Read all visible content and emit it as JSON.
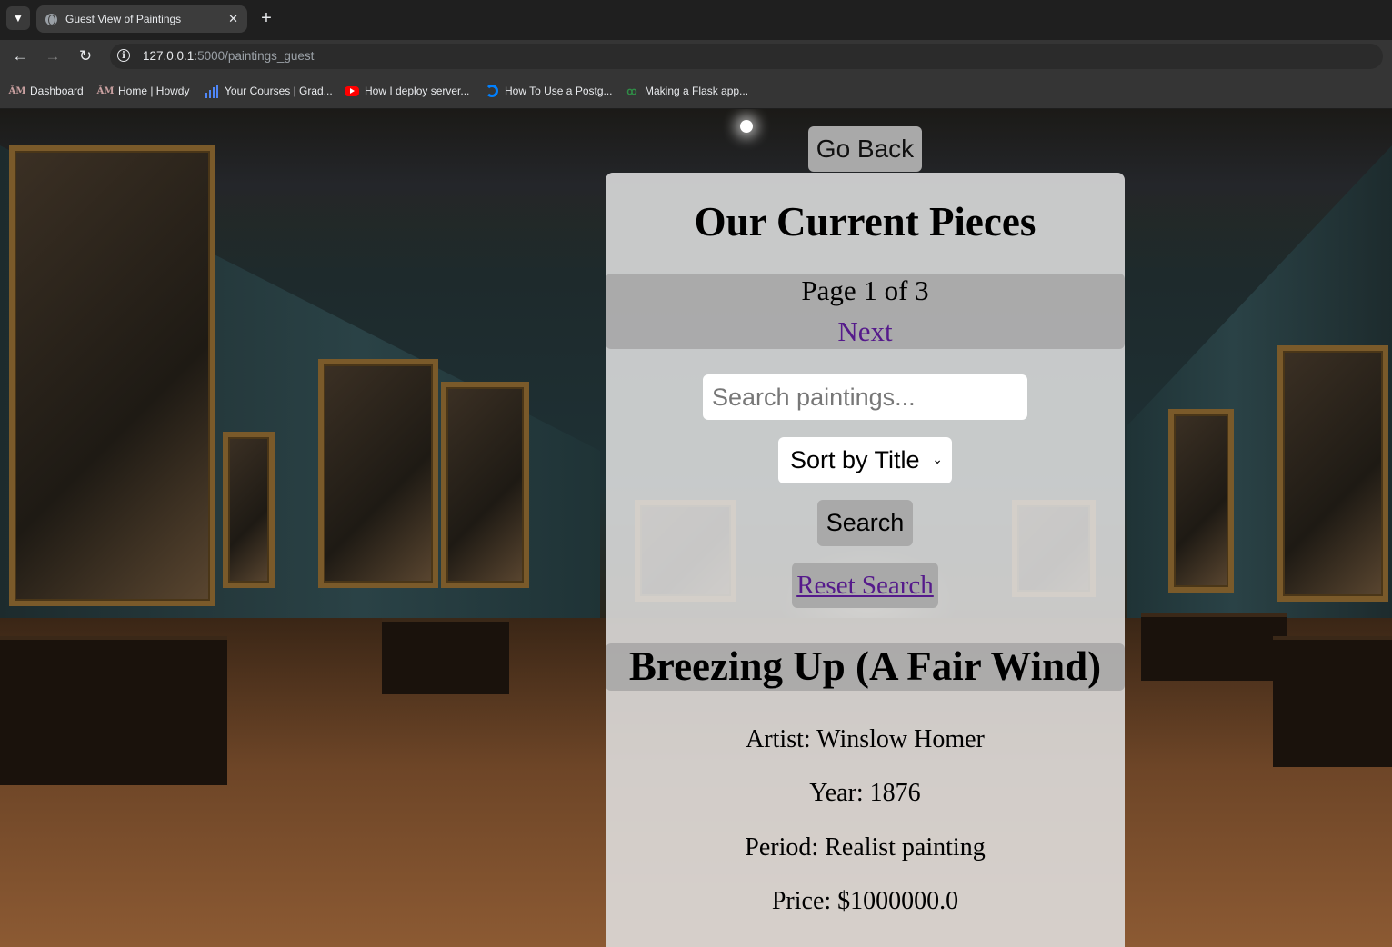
{
  "browser": {
    "tab_title": "Guest View of Paintings",
    "url_host": "127.0.0.1",
    "url_rest": ":5000/paintings_guest",
    "bookmarks": [
      {
        "label": "Dashboard",
        "icon": "tamu-icon"
      },
      {
        "label": "Home | Howdy",
        "icon": "tamu-icon"
      },
      {
        "label": "Your Courses | Grad...",
        "icon": "bar-chart-icon"
      },
      {
        "label": "How I deploy server...",
        "icon": "youtube-icon"
      },
      {
        "label": "How To Use a Postg...",
        "icon": "digitalocean-icon"
      },
      {
        "label": "Making a Flask app...",
        "icon": "geeksforgeeks-icon"
      }
    ]
  },
  "page": {
    "go_back_label": "Go Back",
    "heading": "Our Current Pieces",
    "pagination": {
      "info": "Page 1 of 3",
      "next_label": "Next"
    },
    "search": {
      "placeholder": "Search paintings...",
      "value": ""
    },
    "sort": {
      "selected": "Sort by Title"
    },
    "search_button_label": "Search",
    "reset_label": "Reset Search",
    "painting": {
      "title": "Breezing Up (A Fair Wind)",
      "artist": "Artist: Winslow Homer",
      "year": "Year: 1876",
      "period": "Period: Realist painting",
      "price": "Price: $1000000.0"
    }
  }
}
